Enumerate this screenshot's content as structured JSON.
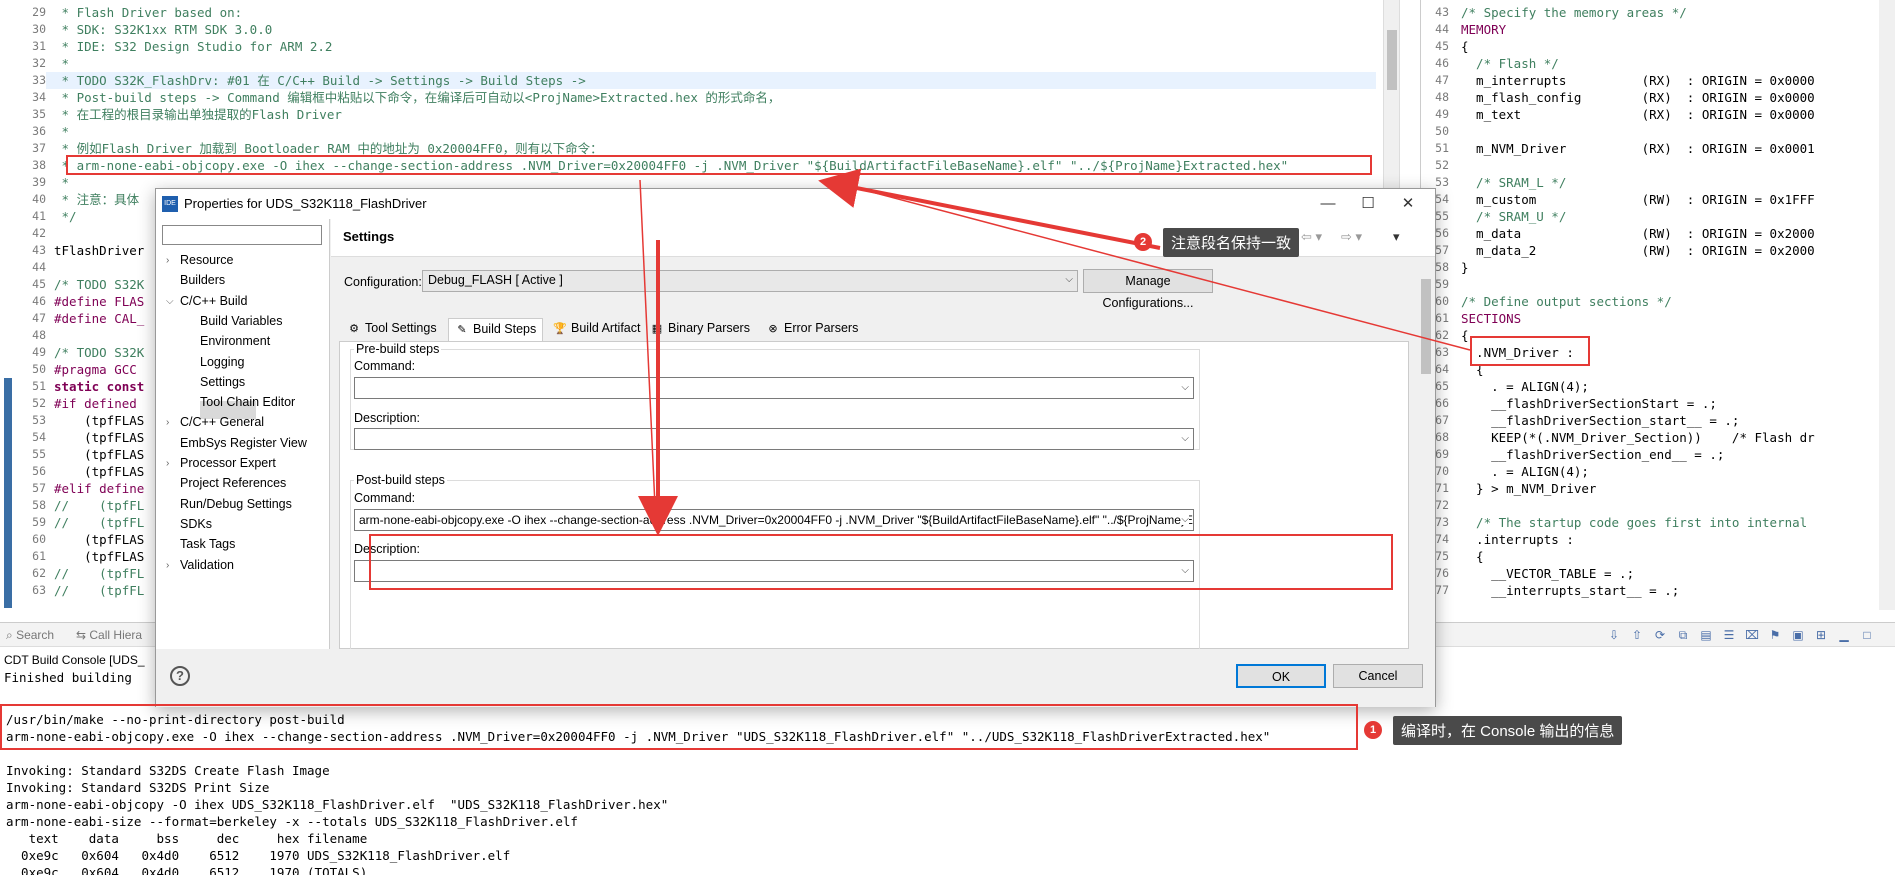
{
  "left_editor": {
    "lines": [
      {
        "n": "29",
        "t": " * Flash Driver based on:",
        "c": "cmt"
      },
      {
        "n": "30",
        "t": " * SDK: S32K1xx RTM SDK 3.0.0",
        "c": "cmt"
      },
      {
        "n": "31",
        "t": " * IDE: S32 Design Studio for ARM 2.2",
        "c": "cmt"
      },
      {
        "n": "32",
        "t": " *",
        "c": "cmt"
      },
      {
        "n": "33",
        "t": " * TODO S32K_FlashDrv: #01 在 C/C++ Build -> Settings -> Build Steps ->",
        "c": "cmt"
      },
      {
        "n": "34",
        "t": " * Post-build steps -> Command 编辑框中粘贴以下命令，在编译后可自动以<ProjName>Extracted.hex 的形式命名，",
        "c": "cmt"
      },
      {
        "n": "35",
        "t": " * 在工程的根目录输出单独提取的Flash Driver",
        "c": "cmt"
      },
      {
        "n": "36",
        "t": " *",
        "c": "cmt"
      },
      {
        "n": "37",
        "t": " * 例如Flash Driver 加载到 Bootloader RAM 中的地址为 0x20004FF0，则有以下命令：",
        "c": "cmt"
      },
      {
        "n": "38",
        "t": " * arm-none-eabi-objcopy.exe -O ihex --change-section-address .NVM_Driver=0x20004FF0 -j .NVM_Driver \"${BuildArtifactFileBaseName}.elf\" \"../${ProjName}Extracted.hex\"",
        "c": "cmt"
      },
      {
        "n": "39",
        "t": " *",
        "c": "cmt"
      },
      {
        "n": "40",
        "t": " * 注意：具体",
        "c": "cmt"
      },
      {
        "n": "41",
        "t": " */",
        "c": "cmt"
      },
      {
        "n": "42",
        "t": "",
        "c": ""
      },
      {
        "n": "43",
        "t": "tFlashDriver",
        "c": ""
      },
      {
        "n": "44",
        "t": "",
        "c": ""
      },
      {
        "n": "45",
        "t": "/* TODO S32K",
        "c": "cmt"
      },
      {
        "n": "46",
        "t": "#define FLAS",
        "c": "pp"
      },
      {
        "n": "47",
        "t": "#define CAL_",
        "c": "pp"
      },
      {
        "n": "48",
        "t": "",
        "c": ""
      },
      {
        "n": "49",
        "t": "/* TODO S32K",
        "c": "cmt"
      },
      {
        "n": "50",
        "t": "#pragma GCC ",
        "c": "pp"
      },
      {
        "n": "51",
        "t": "static const",
        "c": "kw"
      },
      {
        "n": "52",
        "t": "#if defined ",
        "c": "pp"
      },
      {
        "n": "53",
        "t": "    (tpfFLAS",
        "c": ""
      },
      {
        "n": "54",
        "t": "    (tpfFLAS",
        "c": ""
      },
      {
        "n": "55",
        "t": "    (tpfFLAS",
        "c": ""
      },
      {
        "n": "56",
        "t": "    (tpfFLAS",
        "c": ""
      },
      {
        "n": "57",
        "t": "#elif define",
        "c": "pp"
      },
      {
        "n": "58",
        "t": "//    (tpfFL",
        "c": "cmt"
      },
      {
        "n": "59",
        "t": "//    (tpfFL",
        "c": "cmt"
      },
      {
        "n": "60",
        "t": "    (tpfFLAS",
        "c": ""
      },
      {
        "n": "61",
        "t": "    (tpfFLAS",
        "c": ""
      },
      {
        "n": "62",
        "t": "//    (tpfFL",
        "c": "cmt"
      },
      {
        "n": "63",
        "t": "//    (tpfFL",
        "c": "cmt"
      }
    ]
  },
  "right_editor": {
    "lines": [
      {
        "n": "43",
        "t": "/* Specify the memory areas */",
        "c": "cmt"
      },
      {
        "n": "44",
        "t": "MEMORY",
        "c": "mag"
      },
      {
        "n": "45",
        "t": "{",
        "c": ""
      },
      {
        "n": "46",
        "t": "  /* Flash */",
        "c": "cmt"
      },
      {
        "n": "47",
        "t": "  m_interrupts          (RX)  : ORIGIN = 0x0000",
        "c": ""
      },
      {
        "n": "48",
        "t": "  m_flash_config        (RX)  : ORIGIN = 0x0000",
        "c": ""
      },
      {
        "n": "49",
        "t": "  m_text                (RX)  : ORIGIN = 0x0000",
        "c": ""
      },
      {
        "n": "50",
        "t": "",
        "c": ""
      },
      {
        "n": "51",
        "t": "  m_NVM_Driver          (RX)  : ORIGIN = 0x0001",
        "c": ""
      },
      {
        "n": "52",
        "t": "",
        "c": ""
      },
      {
        "n": "53",
        "t": "  /* SRAM_L */",
        "c": "cmt"
      },
      {
        "n": "54",
        "t": "  m_custom              (RW)  : ORIGIN = 0x1FFF",
        "c": ""
      },
      {
        "n": "55",
        "t": "  /* SRAM_U */",
        "c": "cmt"
      },
      {
        "n": "56",
        "t": "  m_data                (RW)  : ORIGIN = 0x2000",
        "c": ""
      },
      {
        "n": "57",
        "t": "  m_data_2              (RW)  : ORIGIN = 0x2000",
        "c": ""
      },
      {
        "n": "58",
        "t": "}",
        "c": ""
      },
      {
        "n": "59",
        "t": "",
        "c": ""
      },
      {
        "n": "60",
        "t": "/* Define output sections */",
        "c": "cmt"
      },
      {
        "n": "61",
        "t": "SECTIONS",
        "c": "mag"
      },
      {
        "n": "62",
        "t": "{",
        "c": ""
      },
      {
        "n": "63",
        "t": "  .NVM_Driver :",
        "c": ""
      },
      {
        "n": "64",
        "t": "  {",
        "c": ""
      },
      {
        "n": "65",
        "t": "    . = ALIGN(4);",
        "c": ""
      },
      {
        "n": "66",
        "t": "    __flashDriverSectionStart = .;",
        "c": ""
      },
      {
        "n": "67",
        "t": "    __flashDriverSection_start__ = .;",
        "c": ""
      },
      {
        "n": "68",
        "t": "    KEEP(*(.NVM_Driver_Section))    /* Flash dr",
        "c": ""
      },
      {
        "n": "69",
        "t": "    __flashDriverSection_end__ = .;",
        "c": ""
      },
      {
        "n": "70",
        "t": "    . = ALIGN(4);",
        "c": ""
      },
      {
        "n": "71",
        "t": "  } > m_NVM_Driver",
        "c": ""
      },
      {
        "n": "72",
        "t": "",
        "c": ""
      },
      {
        "n": "73",
        "t": "  /* The startup code goes first into internal",
        "c": "cmt"
      },
      {
        "n": "74",
        "t": "  .interrupts :",
        "c": ""
      },
      {
        "n": "75",
        "t": "  {",
        "c": ""
      },
      {
        "n": "76",
        "t": "    __VECTOR_TABLE = .;",
        "c": ""
      },
      {
        "n": "77",
        "t": "    __interrupts_start__ = .;",
        "c": ""
      }
    ]
  },
  "console": {
    "tabs": {
      "search": "Search",
      "call_hierarchy": "Call Hiera"
    },
    "title": "CDT Build Console [UDS_",
    "status": "Finished building",
    "lines": [
      "/usr/bin/make --no-print-directory post-build",
      "arm-none-eabi-objcopy.exe -O ihex --change-section-address .NVM_Driver=0x20004FF0 -j .NVM_Driver \"UDS_S32K118_FlashDriver.elf\" \"../UDS_S32K118_FlashDriverExtracted.hex\"",
      "",
      "Invoking: Standard S32DS Create Flash Image",
      "Invoking: Standard S32DS Print Size",
      "arm-none-eabi-objcopy -O ihex UDS_S32K118_FlashDriver.elf  \"UDS_S32K118_FlashDriver.hex\"",
      "arm-none-eabi-size --format=berkeley -x --totals UDS_S32K118_FlashDriver.elf",
      "   text    data     bss     dec     hex filename",
      "  0xe9c   0x604   0x4d0    6512    1970 UDS_S32K118_FlashDriver.elf",
      "  0xe9c   0x604   0x4d0    6512    1970 (TOTALS)"
    ]
  },
  "dialog": {
    "title": "Properties for UDS_S32K118_FlashDriver",
    "app_icon_text": "IDE",
    "tree": [
      {
        "label": "Resource",
        "level": 0,
        "arrow": true
      },
      {
        "label": "Builders",
        "level": 0,
        "arrow": false
      },
      {
        "label": "C/C++ Build",
        "level": 0,
        "arrow": true,
        "open": true
      },
      {
        "label": "Build Variables",
        "level": 1,
        "arrow": false
      },
      {
        "label": "Environment",
        "level": 1,
        "arrow": false
      },
      {
        "label": "Logging",
        "level": 1,
        "arrow": false
      },
      {
        "label": "Settings",
        "level": 1,
        "arrow": false,
        "selected": true
      },
      {
        "label": "Tool Chain Editor",
        "level": 1,
        "arrow": false
      },
      {
        "label": "C/C++ General",
        "level": 0,
        "arrow": true
      },
      {
        "label": "EmbSys Register View",
        "level": 0,
        "arrow": false
      },
      {
        "label": "Processor Expert",
        "level": 0,
        "arrow": true
      },
      {
        "label": "Project References",
        "level": 0,
        "arrow": false
      },
      {
        "label": "Run/Debug Settings",
        "level": 0,
        "arrow": false
      },
      {
        "label": "SDKs",
        "level": 0,
        "arrow": false
      },
      {
        "label": "Task Tags",
        "level": 0,
        "arrow": false
      },
      {
        "label": "Validation",
        "level": 0,
        "arrow": true
      }
    ],
    "settings_title": "Settings",
    "configuration_label": "Configuration:",
    "configuration_value": "Debug_FLASH  [ Active ]",
    "manage_button": "Manage Configurations...",
    "tabs": [
      {
        "label": "Tool Settings",
        "icon": "⚙"
      },
      {
        "label": "Build Steps",
        "icon": "✎",
        "active": true
      },
      {
        "label": "Build Artifact",
        "icon": "🏆"
      },
      {
        "label": "Binary Parsers",
        "icon": "▦"
      },
      {
        "label": "Error Parsers",
        "icon": "⊗"
      }
    ],
    "pre_build": {
      "group": "Pre-build steps",
      "command_label": "Command:",
      "command_value": "",
      "description_label": "Description:",
      "description_value": ""
    },
    "post_build": {
      "group": "Post-build steps",
      "command_label": "Command:",
      "command_value": "arm-none-eabi-objcopy.exe -O ihex --change-section-address .NVM_Driver=0x20004FF0 -j .NVM_Driver \"${BuildArtifactFileBaseName}.elf\" \"../${ProjName}Extracted.hex\"",
      "description_label": "Description:",
      "description_value": ""
    },
    "ok_button": "OK",
    "cancel_button": "Cancel",
    "help_icon": "?"
  },
  "annotations": {
    "callout_1": {
      "num": "1",
      "text": "编译时，在 Console 输出的信息"
    },
    "callout_2": {
      "num": "2",
      "text": "注意段名保持一致"
    },
    "color": "#e53935"
  }
}
